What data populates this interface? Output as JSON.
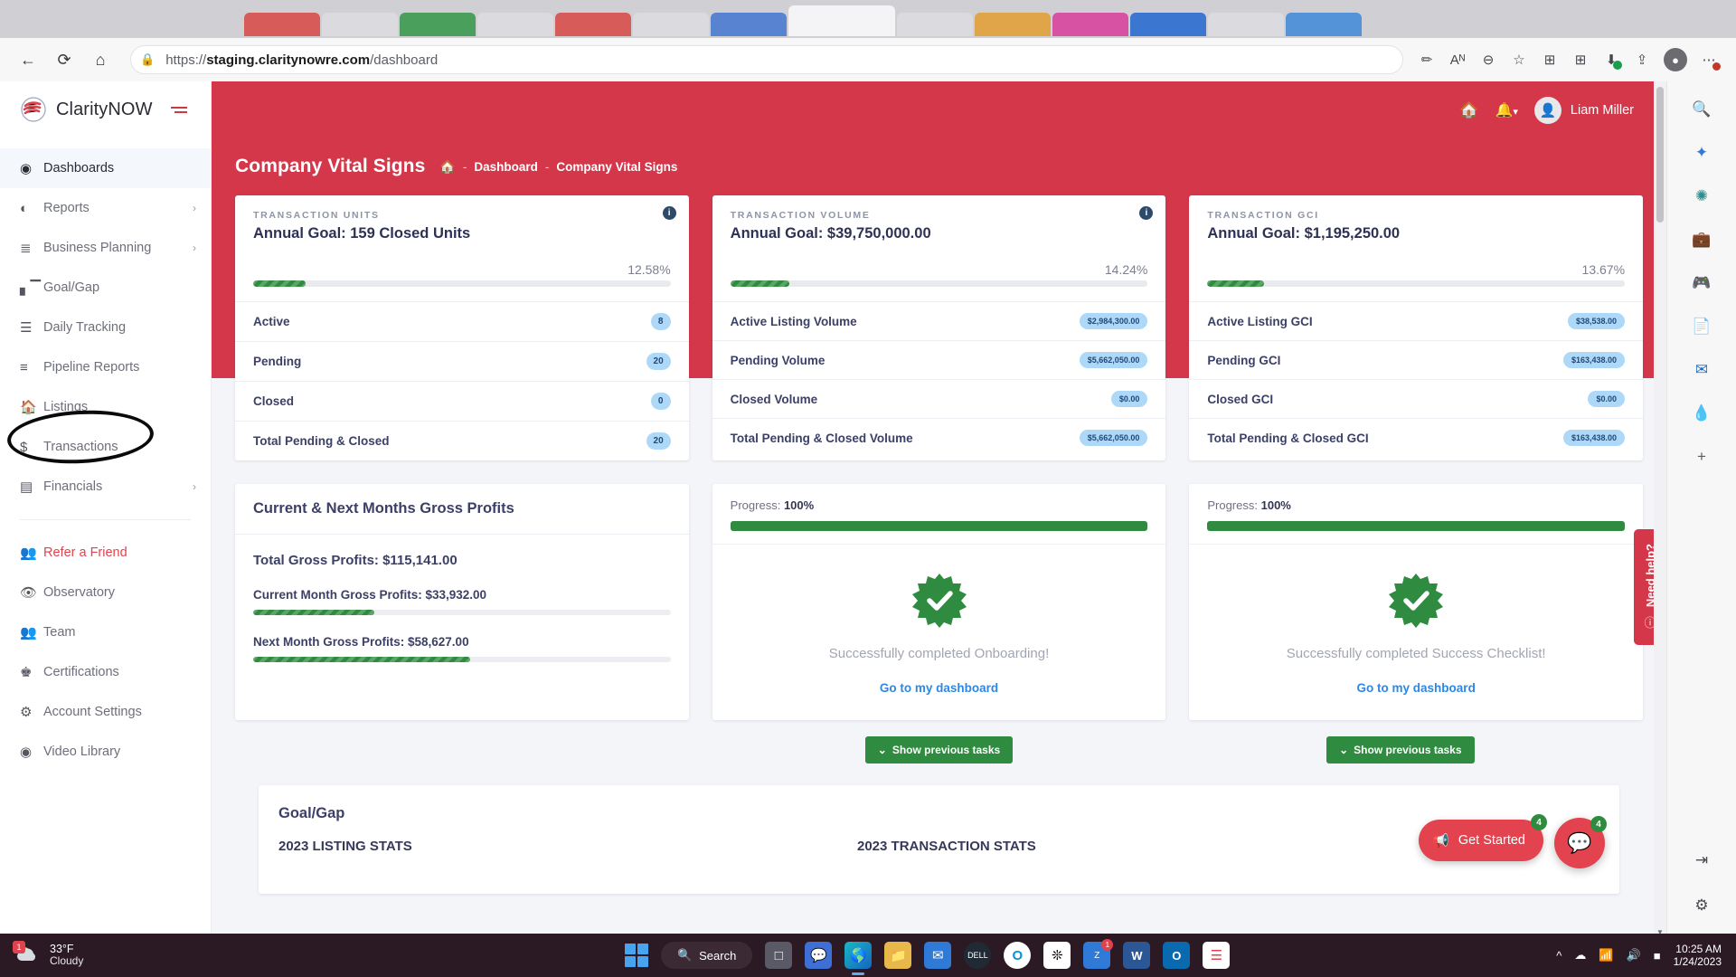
{
  "browser": {
    "url_prefix": "https://",
    "url_host": "staging.claritynowre.com",
    "url_path": "/dashboard",
    "back_icon": "←",
    "refresh_icon": "⟳",
    "home_icon": "⌂",
    "lock_icon": "🔒",
    "icons": {
      "pen": "✏",
      "read_aloud": "Aᴺ",
      "zoom_out": "⊖",
      "favorite": "☆",
      "collections": "⊞",
      "downloads": "⭳",
      "share": "⇪",
      "profile": "●",
      "settings_more": "⋯"
    }
  },
  "sidebar": {
    "brand": "ClarityNOW",
    "collapse_icon": "hamburger-icon",
    "items": [
      {
        "label": "Dashboards",
        "icon": "dashboard-icon",
        "active": true,
        "chevron": false,
        "accent": false
      },
      {
        "label": "Reports",
        "icon": "pie-chart-icon",
        "active": false,
        "chevron": true,
        "accent": false
      },
      {
        "label": "Business Planning",
        "icon": "checklist-icon",
        "active": false,
        "chevron": true,
        "accent": false
      },
      {
        "label": "Goal/Gap",
        "icon": "bar-chart-icon",
        "active": false,
        "chevron": false,
        "accent": false
      },
      {
        "label": "Daily Tracking",
        "icon": "list-icon",
        "active": false,
        "chevron": false,
        "accent": false
      },
      {
        "label": "Pipeline Reports",
        "icon": "lines-icon",
        "active": false,
        "chevron": false,
        "accent": false
      },
      {
        "label": "Listings",
        "icon": "home-icon",
        "active": false,
        "chevron": false,
        "accent": false
      },
      {
        "label": "Transactions",
        "icon": "dollar-icon",
        "active": false,
        "chevron": false,
        "accent": false
      },
      {
        "label": "Financials",
        "icon": "coins-icon",
        "active": false,
        "chevron": true,
        "accent": false
      }
    ],
    "items2": [
      {
        "label": "Refer a Friend",
        "icon": "people-icon",
        "accent": true
      },
      {
        "label": "Observatory",
        "icon": "eye-icon",
        "accent": false
      },
      {
        "label": "Team",
        "icon": "team-icon",
        "accent": false
      },
      {
        "label": "Certifications",
        "icon": "crown-icon",
        "accent": false
      },
      {
        "label": "Account Settings",
        "icon": "gear-icon",
        "accent": false
      },
      {
        "label": "Video Library",
        "icon": "play-icon",
        "accent": false
      }
    ],
    "annotation": "hand-drawn-ellipse-around-daily-tracking"
  },
  "topbar": {
    "home_icon": "home-icon",
    "bell_icon": "bell-icon",
    "chevron": "▾",
    "user_name": "Liam Miller",
    "avatar_icon": "avatar-icon"
  },
  "header": {
    "title": "Company Vital Signs",
    "breadcrumb": [
      "Dashboard",
      "Company Vital Signs"
    ],
    "home_icon": "home-icon",
    "separator": "-"
  },
  "kpi_cards": [
    {
      "eyebrow": "TRANSACTION UNITS",
      "title": "Annual Goal: 159 Closed Units",
      "percent": "12.58%",
      "percent_value": 12.58,
      "info_icon": "info-icon",
      "rows": [
        {
          "label": "Active",
          "value": "8"
        },
        {
          "label": "Pending",
          "value": "20"
        },
        {
          "label": "Closed",
          "value": "0"
        },
        {
          "label": "Total Pending & Closed",
          "value": "20"
        }
      ]
    },
    {
      "eyebrow": "TRANSACTION VOLUME",
      "title": "Annual Goal: $39,750,000.00",
      "percent": "14.24%",
      "percent_value": 14.24,
      "info_icon": "info-icon",
      "rows": [
        {
          "label": "Active Listing Volume",
          "value": "$2,984,300.00"
        },
        {
          "label": "Pending Volume",
          "value": "$5,662,050.00"
        },
        {
          "label": "Closed Volume",
          "value": "$0.00"
        },
        {
          "label": "Total Pending & Closed Volume",
          "value": "$5,662,050.00"
        }
      ]
    },
    {
      "eyebrow": "TRANSACTION GCI",
      "title": "Annual Goal: $1,195,250.00",
      "percent": "13.67%",
      "percent_value": 13.67,
      "info_icon": "info-icon",
      "rows": [
        {
          "label": "Active Listing GCI",
          "value": "$38,538.00"
        },
        {
          "label": "Pending GCI",
          "value": "$163,438.00"
        },
        {
          "label": "Closed GCI",
          "value": "$0.00"
        },
        {
          "label": "Total Pending & Closed GCI",
          "value": "$163,438.00"
        }
      ]
    }
  ],
  "gross_profits": {
    "title": "Current & Next Months Gross Profits",
    "total": "Total Gross Profits: $115,141.00",
    "current_label": "Current Month Gross Profits: $33,932.00",
    "current_percent": 29,
    "next_label": "Next Month Gross Profits: $58,627.00",
    "next_percent": 52
  },
  "checklists": [
    {
      "progress_label": "Progress:",
      "progress_value": "100%",
      "progress_percent": 100,
      "message": "Successfully completed Onboarding!",
      "link": "Go to my dashboard",
      "badge_icon": "check-badge-icon",
      "prev_button": "Show previous tasks",
      "prev_chevron": "⌄"
    },
    {
      "progress_label": "Progress:",
      "progress_value": "100%",
      "progress_percent": 100,
      "message": "Successfully completed Success Checklist!",
      "link": "Go to my dashboard",
      "badge_icon": "check-badge-icon",
      "prev_button": "Show previous tasks",
      "prev_chevron": "⌄"
    }
  ],
  "goalgap": {
    "title": "Goal/Gap",
    "sections": [
      "2023 LISTING STATS",
      "2023 TRANSACTION STATS"
    ]
  },
  "floating": {
    "need_help": "Need help?",
    "need_help_icon": "question-circle-icon",
    "get_started": "Get Started",
    "get_started_count": "4",
    "get_started_icon": "megaphone-icon",
    "chat_icon": "chat-icon",
    "chat_count": "4"
  },
  "edge_rail": {
    "icons": [
      "search-icon",
      "copilot-icon",
      "shopping-icon",
      "tools-icon",
      "games-icon",
      "office-icon",
      "outlook-icon",
      "drop-icon",
      "add-icon",
      "split-screen-icon",
      "settings-icon"
    ]
  },
  "taskbar": {
    "weather_temp": "33°F",
    "weather_cond": "Cloudy",
    "weather_badge": "1",
    "search_label": "Search",
    "search_icon": "search-icon",
    "start_icon": "windows-icon",
    "apps": [
      "task-view-icon",
      "chat-icon",
      "edge-icon",
      "explorer-icon",
      "mail-icon",
      "dell-icon",
      "browser-o-icon",
      "slack-icon",
      "zoom-icon",
      "word-icon",
      "outlook-icon",
      "claritynow-icon"
    ],
    "zoom_badge": "1",
    "tray": [
      "chevron-up-icon",
      "cloud-icon",
      "wifi-icon",
      "speaker-icon",
      "battery-icon"
    ],
    "time": "10:25 AM",
    "date": "1/24/2023"
  },
  "colors": {
    "brand_red": "#d5374a",
    "accent_red": "#e0434d",
    "green": "#2f8b3f",
    "pill_blue": "#aed8f7",
    "link_blue": "#2e87e0",
    "heading_navy": "#3c4067"
  }
}
